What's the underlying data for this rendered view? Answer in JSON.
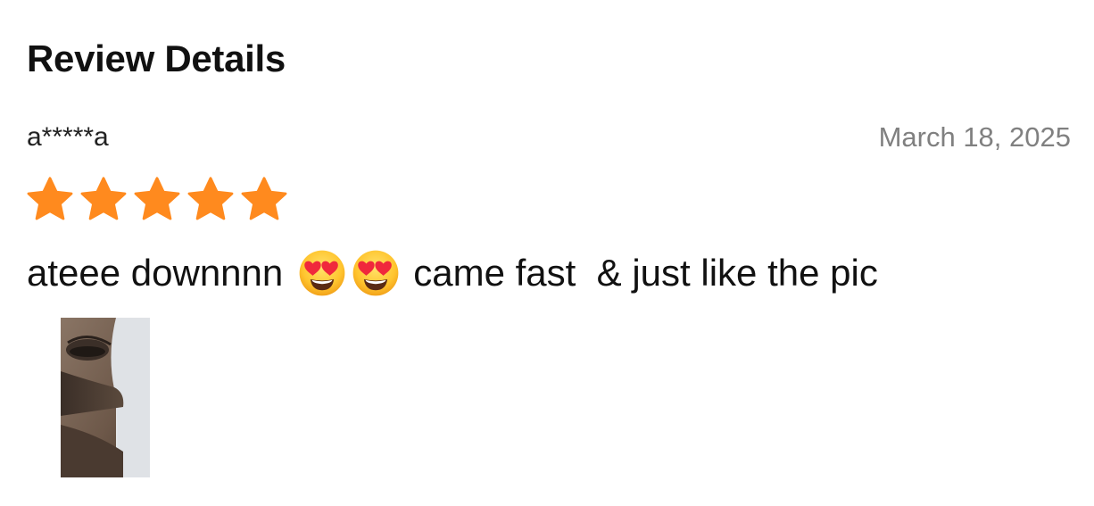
{
  "header": {
    "title": "Review Details"
  },
  "review": {
    "reviewer": "a*****a",
    "date": "March 18, 2025",
    "rating": 5,
    "rating_max": 5,
    "text_before": "ateee downnnn",
    "emojis": [
      "smiling-face-with-heart-eyes",
      "smiling-face-with-heart-eyes"
    ],
    "text_after": "came fast  & just like the pic",
    "photo_count": 1
  },
  "colors": {
    "star": "#FF8A1E",
    "date": "#808080",
    "text": "#111111"
  }
}
